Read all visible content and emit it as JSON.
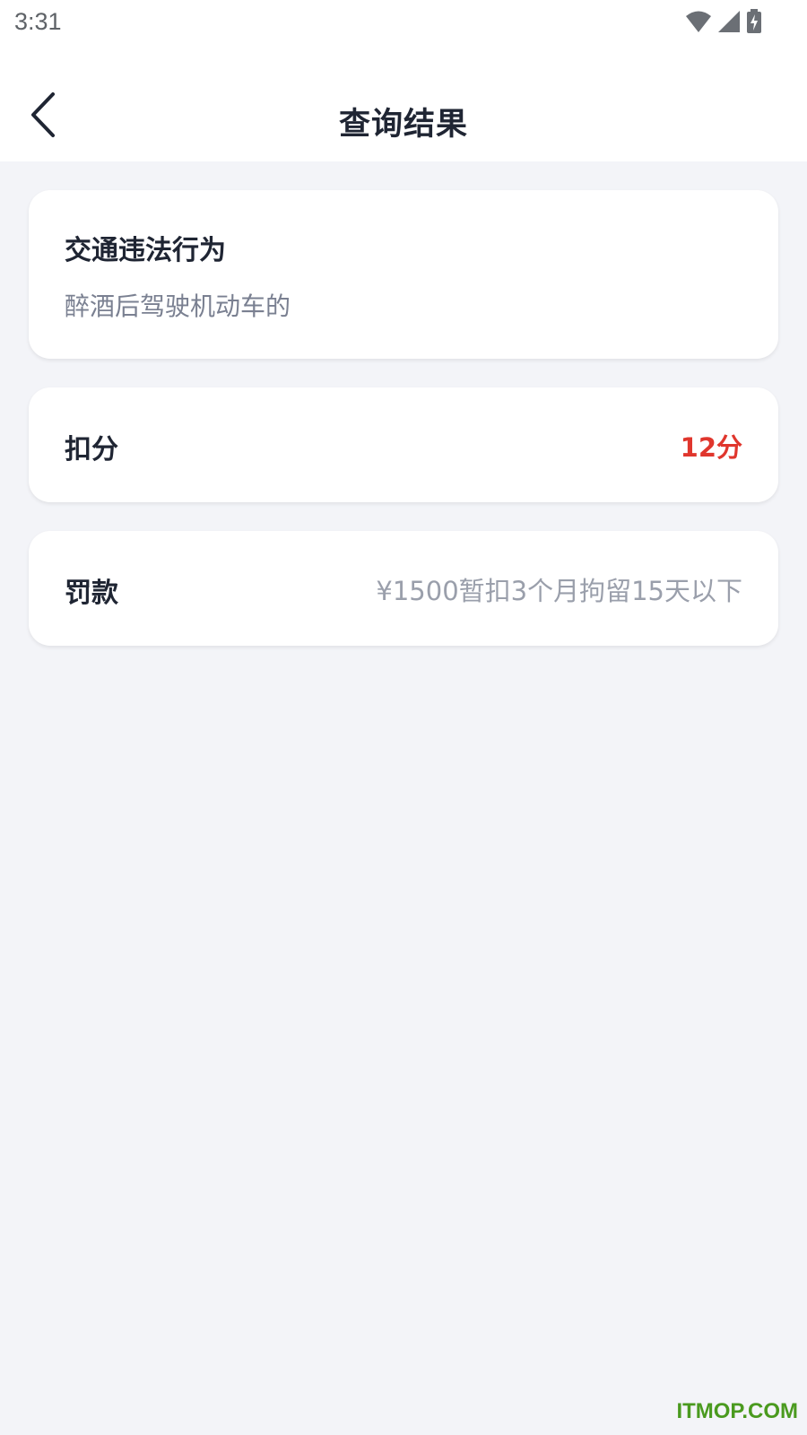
{
  "status_bar": {
    "time": "3:31",
    "icons": [
      "wifi-icon",
      "cell-signal-icon",
      "battery-charging-icon"
    ]
  },
  "app_bar": {
    "back_icon": "chevron-left-icon",
    "title": "查询结果"
  },
  "violation_card": {
    "title": "交通违法行为",
    "description": "醉酒后驾驶机动车的"
  },
  "points_card": {
    "label": "扣分",
    "value": "12分"
  },
  "fine_card": {
    "label": "罚款",
    "value": "¥1500暂扣3个月拘留15天以下"
  },
  "watermark": "ITMOP.COM",
  "colors": {
    "background": "#f3f4f8",
    "card": "#ffffff",
    "title_text": "#1f2533",
    "secondary_text": "#7a8091",
    "points_accent": "#e0362d",
    "fine_text": "#9a9fab",
    "watermark": "#4a9a1f"
  }
}
